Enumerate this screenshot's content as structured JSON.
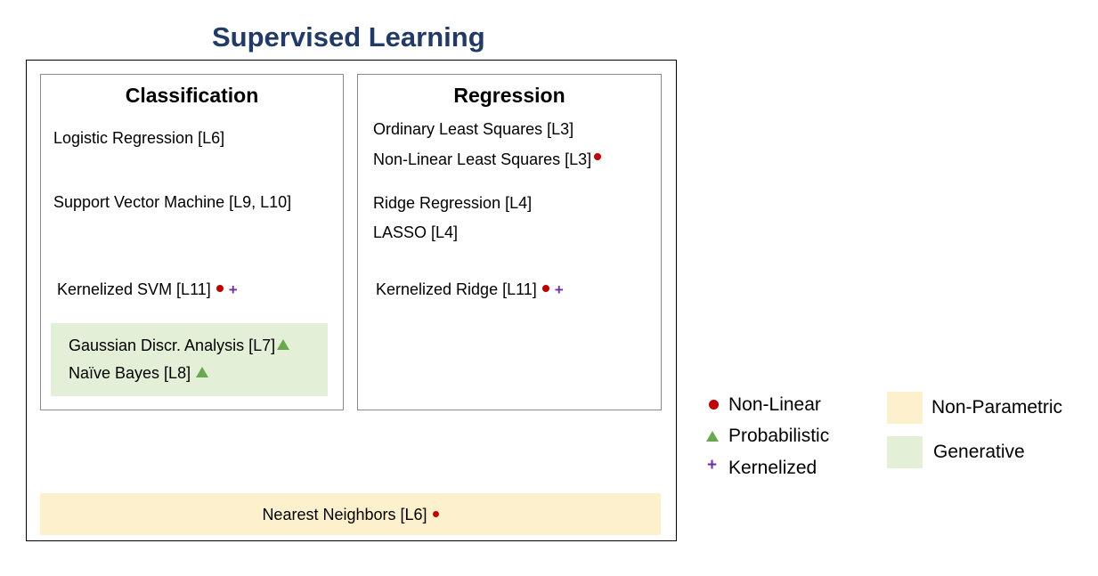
{
  "title": "Supervised Learning",
  "colors": {
    "title": "#213a66",
    "non_linear": "#c00000",
    "probabilistic": "#6aa84f",
    "kernelized": "#7030a0",
    "generative_bg": "#e3efd7",
    "non_parametric_bg": "#fdf1cd"
  },
  "icons": {
    "non_linear": "dot-icon",
    "probabilistic": "triangle-icon",
    "kernelized": "plus-icon"
  },
  "classification": {
    "title": "Classification",
    "logistic": "Logistic Regression [L6]",
    "svm": "Support Vector Machine [L9, L10]",
    "kernel_svm": "Kernelized SVM [L11]",
    "gda": "Gaussian Discr. Analysis [L7]",
    "naive_bayes": "Naïve Bayes [L8]"
  },
  "regression": {
    "title": "Regression",
    "ols": "Ordinary Least Squares [L3]",
    "nlls": "Non-Linear Least Squares [L3]",
    "ridge": "Ridge Regression [L4]",
    "lasso": "LASSO [L4]",
    "kernel_ridge": "Kernelized Ridge [L11]"
  },
  "nearest_neighbors": "Nearest Neighbors [L6]",
  "legend": {
    "non_linear": "Non-Linear",
    "probabilistic": "Probabilistic",
    "kernelized": "Kernelized",
    "non_parametric": "Non-Parametric",
    "generative": "Generative"
  }
}
